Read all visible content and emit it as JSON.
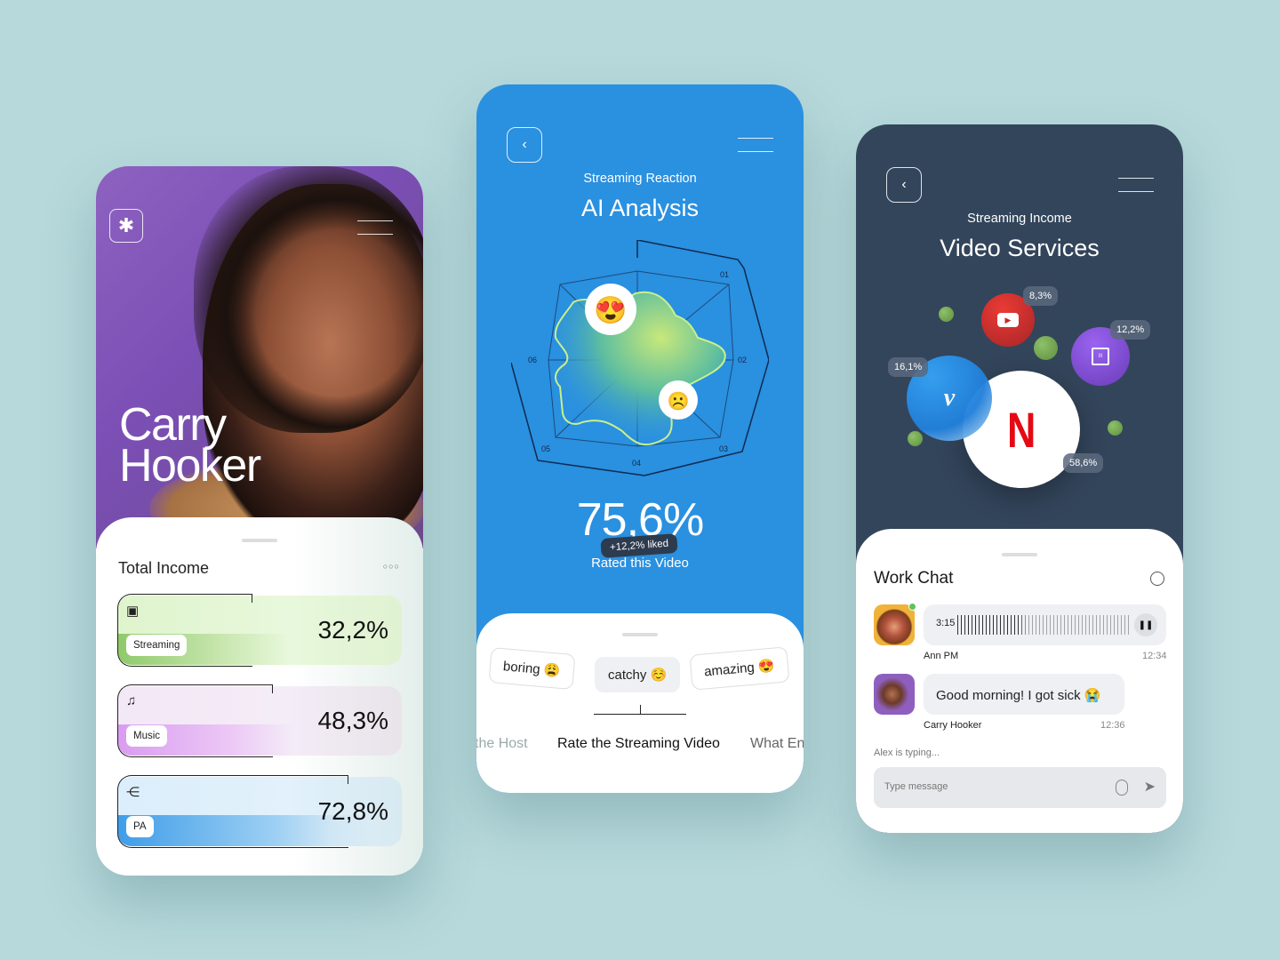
{
  "profile_card": {
    "name_line1": "Carry",
    "name_line2": "Hooker",
    "logo_icon": "asterisk-icon",
    "menu_icon": "hamburger-menu-icon",
    "section_title": "Total Income",
    "more_icon": "more-dots-icon",
    "income_items": [
      {
        "icon": "video-reel-icon",
        "label": "Streaming",
        "value": "32,2%",
        "color": "#b8e39a"
      },
      {
        "icon": "music-note-icon",
        "label": "Music",
        "value": "48,3%",
        "color": "#dca4f2"
      },
      {
        "icon": "flow-branch-icon",
        "label": "PA",
        "value": "72,8%",
        "color": "#4aa3ea"
      }
    ]
  },
  "analysis_card": {
    "back_icon": "chevron-left-icon",
    "menu_icon": "hamburger-menu-icon",
    "subtitle": "Streaming Reaction",
    "title": "AI Analysis",
    "radar_labels": [
      "01",
      "02",
      "03",
      "04",
      "05",
      "06"
    ],
    "reaction_icons": [
      "heart-eyes-emoji",
      "frowning-face-emoji"
    ],
    "big_value": "75,6%",
    "liked_badge": "+12,2% liked",
    "rated_label": "Rated this Video",
    "chips": [
      {
        "label": "boring",
        "emoji": "😩"
      },
      {
        "label": "catchy",
        "emoji": "☺️"
      },
      {
        "label": "amazing",
        "emoji": "😍"
      }
    ],
    "carousel": [
      "the Host",
      "Rate the Streaming Video",
      "What En"
    ],
    "accent": "#2a90e0"
  },
  "services_card": {
    "back_icon": "chevron-left-icon",
    "menu_icon": "hamburger-menu-icon",
    "subtitle": "Streaming Income",
    "title": "Video Services",
    "services": [
      {
        "name": "YouTube",
        "value": "8,3%",
        "color": "#d8302c"
      },
      {
        "name": "Twitch",
        "value": "12,2%",
        "color": "#8a55e0"
      },
      {
        "name": "Vimeo",
        "value": "16,1%",
        "color": "#2b8fe8"
      },
      {
        "name": "Netflix",
        "value": "58,6%",
        "color": "#e50914"
      }
    ],
    "chat_title": "Work Chat",
    "search_icon": "search-icon",
    "messages": [
      {
        "sender": "Ann PM",
        "time": "12:34",
        "voice_duration": "3:15",
        "type": "voice"
      },
      {
        "sender": "Carry Hooker",
        "time": "12:36",
        "text": "Good morning! I got sick",
        "emoji": "😭",
        "type": "text"
      }
    ],
    "typing_status": "Alex is typing...",
    "input_placeholder": "Type message"
  }
}
